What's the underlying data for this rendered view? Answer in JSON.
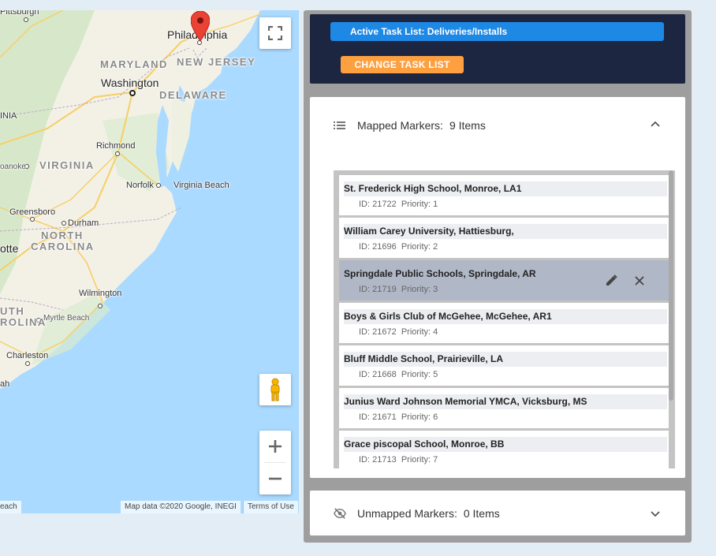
{
  "map": {
    "labels": {
      "pittsburgh": "Pittsburgh",
      "philadelphia": "Philadelphia",
      "maryland": "MARYLAND",
      "new_jersey": "NEW JERSEY",
      "washington": "Washington",
      "delaware": "DELAWARE",
      "richmond": "Richmond",
      "virginia": "VIRGINIA",
      "roanoke": "oanoke",
      "norfolk": "Norfolk",
      "virginia_beach": "Virginia Beach",
      "greensboro": "Greensboro",
      "durham": "Durham",
      "north": "NORTH",
      "carolina": "CAROLINA",
      "charlotte": "otte",
      "wilmington": "Wilmington",
      "south": "UTH",
      "south_carolina": "ROLINA",
      "myrtle_beach": "Myrtle Beach",
      "charleston": "Charleston",
      "savannah": "ah",
      "inia": "INIA",
      "beach_edge": "each"
    },
    "attribution": "Map data ©2020 Google, INEGI",
    "terms": "Terms of Use",
    "icons": {
      "fullscreen": "fullscreen-icon",
      "pegman": "pegman-icon",
      "zoom_in": "plus-icon",
      "zoom_out": "minus-icon",
      "marker": "map-pin-icon"
    }
  },
  "header": {
    "active_task": "Active Task List: Deliveries/Installs",
    "change_button": "CHANGE TASK LIST"
  },
  "mapped": {
    "title": "Mapped Markers:",
    "count": "9 Items",
    "items": [
      {
        "name": "St. Frederick High School, Monroe, LA1",
        "id": "ID: 21722",
        "priority": "Priority: 1"
      },
      {
        "name": "William Carey University, Hattiesburg,",
        "id": "ID: 21696",
        "priority": "Priority: 2"
      },
      {
        "name": "Springdale Public Schools, Springdale, AR",
        "id": "ID: 21719",
        "priority": "Priority: 3"
      },
      {
        "name": "Boys & Girls Club of McGehee, McGehee, AR1",
        "id": "ID: 21672",
        "priority": "Priority: 4"
      },
      {
        "name": "Bluff Middle School, Prairieville, LA",
        "id": "ID: 21668",
        "priority": "Priority: 5"
      },
      {
        "name": "Junius Ward Johnson Memorial YMCA, Vicksburg, MS",
        "id": "ID: 21671",
        "priority": "Priority: 6"
      },
      {
        "name": "Grace piscopal School, Monroe, BB",
        "id": "ID: 21713",
        "priority": "Priority: 7"
      }
    ]
  },
  "unmapped": {
    "title": "Unmapped Markers:",
    "count": "0 Items"
  },
  "colors": {
    "header_bg": "#1c2640",
    "accent_blue": "#1e88e5",
    "accent_orange": "#ffa040",
    "water": "#aadaff",
    "marker_red": "#ea4335"
  }
}
